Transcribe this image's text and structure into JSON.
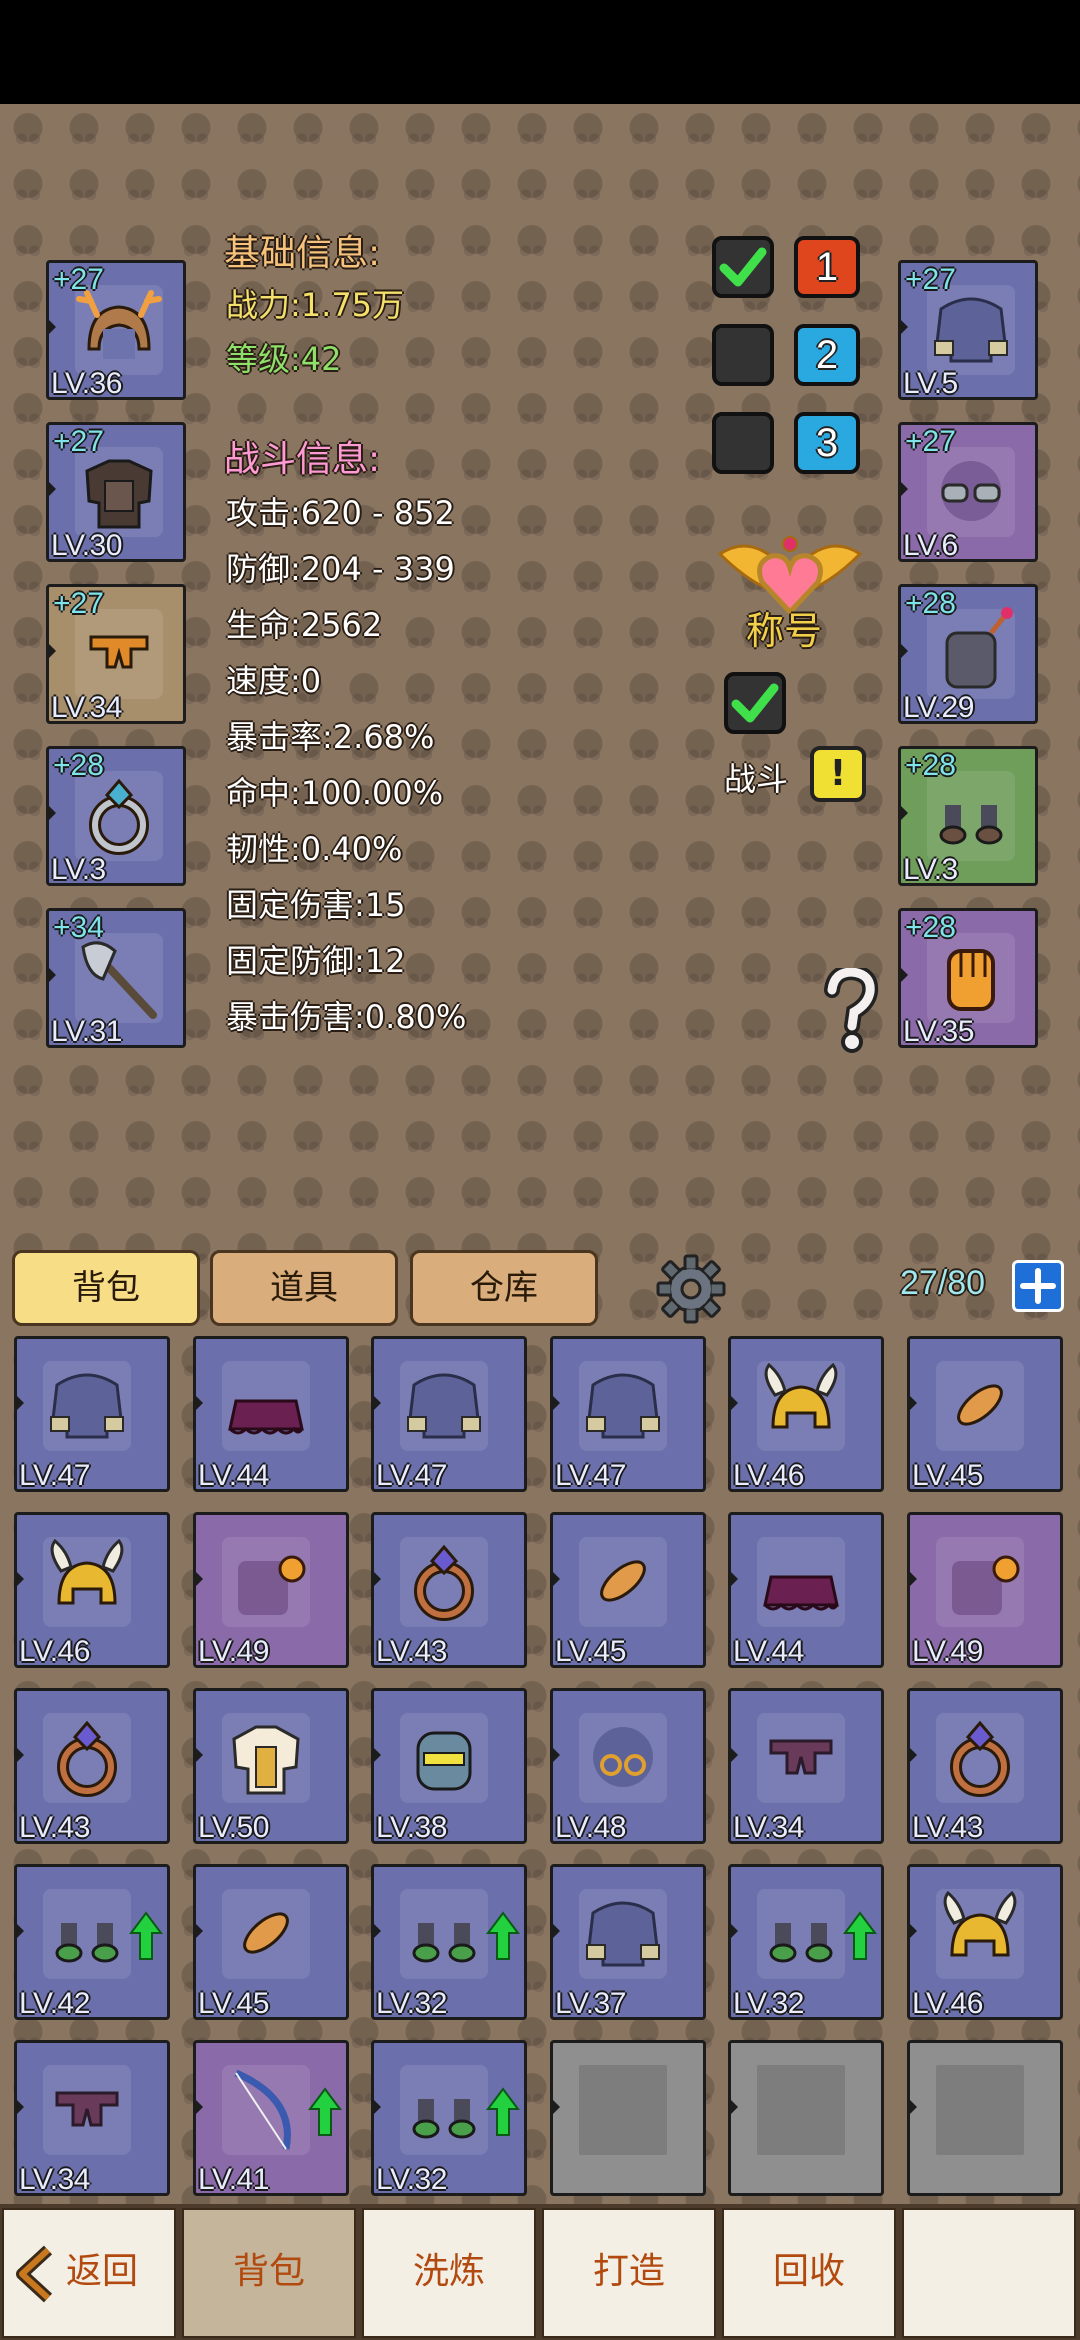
{
  "basic_info": {
    "header": "基础信息:",
    "power": "战力:1.75万",
    "level": "等级:42"
  },
  "battle_info": {
    "header": "战斗信息:",
    "stats": [
      "攻击:620 - 852",
      "防御:204 - 339",
      "生命:2562",
      "速度:0",
      "暴击率:2.68%",
      "命中:100.00%",
      "韧性:0.40%",
      "固定伤害:15",
      "固定防御:12",
      "暴击伤害:0.80%"
    ]
  },
  "equipped_left": [
    {
      "plus": "+27",
      "lv": "LV.36",
      "item": "antler-helmet-icon"
    },
    {
      "plus": "+27",
      "lv": "LV.30",
      "item": "armor-icon"
    },
    {
      "plus": "+27",
      "lv": "LV.34",
      "item": "pants-icon"
    },
    {
      "plus": "+28",
      "lv": "LV.3",
      "item": "ring-icon"
    },
    {
      "plus": "+34",
      "lv": "LV.31",
      "item": "axe-icon"
    }
  ],
  "equipped_right": [
    {
      "plus": "+27",
      "lv": "LV.5",
      "item": "gloves-icon"
    },
    {
      "plus": "+27",
      "lv": "LV.6",
      "item": "goggles-icon"
    },
    {
      "plus": "+28",
      "lv": "LV.29",
      "item": "backpack-icon"
    },
    {
      "plus": "+28",
      "lv": "LV.3",
      "item": "boots-icon"
    },
    {
      "plus": "+28",
      "lv": "LV.35",
      "item": "fist-icon"
    }
  ],
  "loadouts": [
    {
      "number": "1",
      "checked": true
    },
    {
      "number": "2",
      "checked": false
    },
    {
      "number": "3",
      "checked": false
    }
  ],
  "title_label": "称号",
  "battle_label": "战斗",
  "battle_alert": "!",
  "help_icon": "question-icon",
  "tabs": [
    "背包",
    "道具",
    "仓库"
  ],
  "capacity": "27/80",
  "inventory": [
    {
      "lv": "LV.47",
      "item": "shirt"
    },
    {
      "lv": "LV.44",
      "item": "skirt"
    },
    {
      "lv": "LV.47",
      "item": "shirt"
    },
    {
      "lv": "LV.47",
      "item": "shirt"
    },
    {
      "lv": "LV.46",
      "item": "winged-helmet"
    },
    {
      "lv": "LV.45",
      "item": "bread"
    },
    {
      "lv": "LV.46",
      "item": "winged-helmet"
    },
    {
      "lv": "LV.49",
      "item": "gauntlet"
    },
    {
      "lv": "LV.43",
      "item": "ring"
    },
    {
      "lv": "LV.45",
      "item": "bread"
    },
    {
      "lv": "LV.44",
      "item": "skirt"
    },
    {
      "lv": "LV.49",
      "item": "gauntlet"
    },
    {
      "lv": "LV.43",
      "item": "ring"
    },
    {
      "lv": "LV.50",
      "item": "chestplate"
    },
    {
      "lv": "LV.38",
      "item": "robot-helmet"
    },
    {
      "lv": "LV.48",
      "item": "glasses"
    },
    {
      "lv": "LV.34",
      "item": "shorts"
    },
    {
      "lv": "LV.43",
      "item": "ring"
    },
    {
      "lv": "LV.42",
      "item": "shoes",
      "up": true
    },
    {
      "lv": "LV.45",
      "item": "bread"
    },
    {
      "lv": "LV.32",
      "item": "shoes",
      "up": true
    },
    {
      "lv": "LV.37",
      "item": "shirt"
    },
    {
      "lv": "LV.32",
      "item": "shoes",
      "up": true
    },
    {
      "lv": "LV.46",
      "item": "winged-helmet"
    },
    {
      "lv": "LV.34",
      "item": "shorts"
    },
    {
      "lv": "LV.41",
      "item": "bow",
      "up": true
    },
    {
      "lv": "LV.32",
      "item": "shoes",
      "up": true
    },
    {
      "lv": "",
      "item": "empty"
    },
    {
      "lv": "",
      "item": "empty"
    },
    {
      "lv": "",
      "item": "empty"
    }
  ],
  "bottom_nav": [
    "返回",
    "背包",
    "洗炼",
    "打造",
    "回收",
    ""
  ]
}
